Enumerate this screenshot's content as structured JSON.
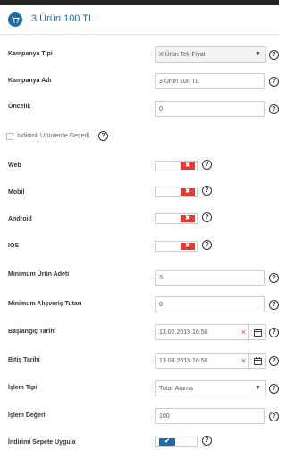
{
  "header": {
    "title": "3 Ürün 100 TL",
    "icon": "cart-icon"
  },
  "colon": ":",
  "help_glyph": "?",
  "fields": {
    "kampanya_tipi": {
      "label": "Kampanya Tipi",
      "value": "X Ürün Tek Fiyat"
    },
    "kampanya_adi": {
      "label": "Kampanya Adı",
      "value": "3 Ürün 100 TL"
    },
    "oncelik": {
      "label": "Öncelik",
      "value": "0"
    },
    "indirimli": {
      "label": "İndirimli Ürünlerde Geçerli",
      "checked": false
    },
    "web": {
      "label": "Web",
      "state": "off"
    },
    "mobil": {
      "label": "Mobil",
      "state": "off"
    },
    "android": {
      "label": "Android",
      "state": "off"
    },
    "ios": {
      "label": "IOS",
      "state": "off"
    },
    "min_urun": {
      "label": "Minimum Ürün Adeti",
      "value": "3"
    },
    "min_tutar": {
      "label": "Minimum Alışveriş Tutarı",
      "value": "0"
    },
    "baslangic": {
      "label": "Başlangıç Tarihi",
      "value": "13.02.2019 16:50"
    },
    "bitis": {
      "label": "Bitiş Tarihi",
      "value": "13.03.2019 16:50"
    },
    "islem_tipi": {
      "label": "İşlem Tipi",
      "value": "Tutar Atama"
    },
    "islem_degeri": {
      "label": "İşlem Değeri",
      "value": "100"
    },
    "sepete_uygula": {
      "label": "İndirimi Sepete Uygula",
      "state": "on"
    }
  },
  "glyphs": {
    "off": "✖",
    "on": "✔",
    "arrow": "▼",
    "clear": "×"
  },
  "colors": {
    "accent": "#1f6aa8",
    "off": "#e53935"
  }
}
